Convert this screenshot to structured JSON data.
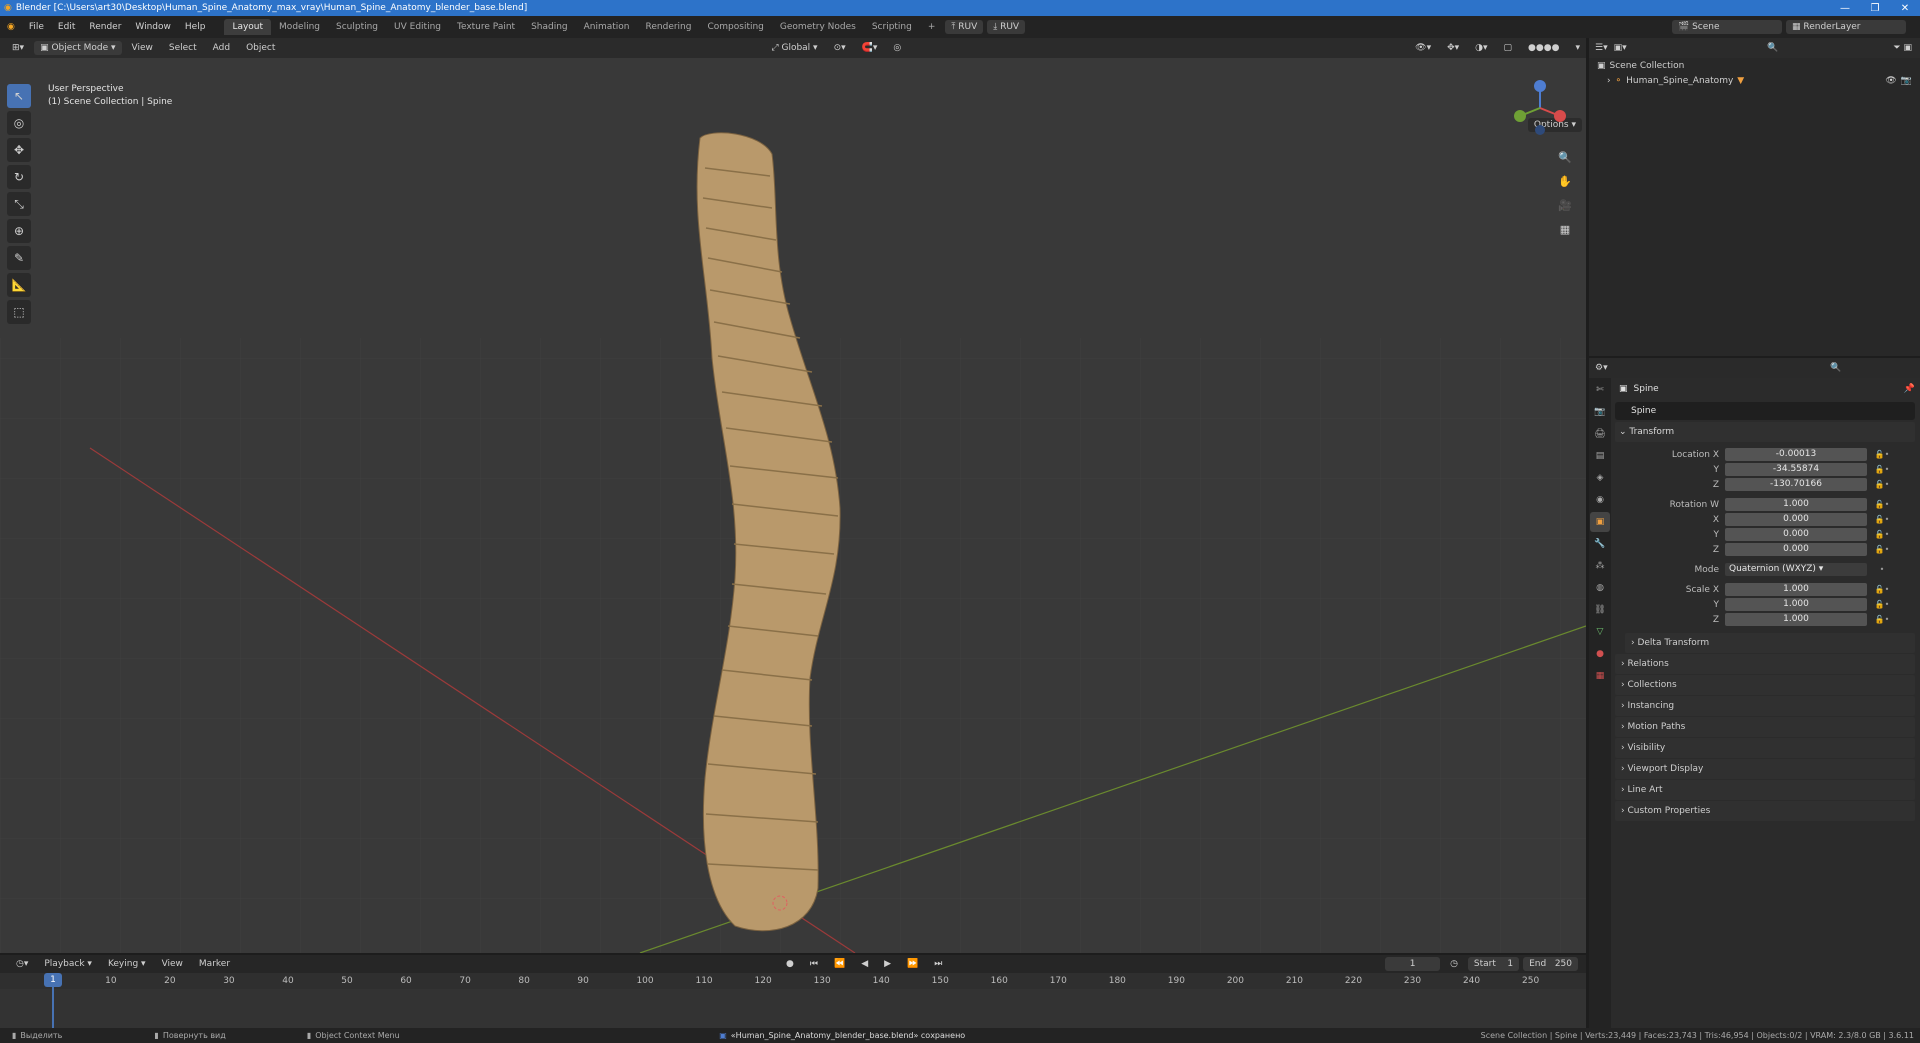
{
  "titlebar": {
    "title": "Blender [C:\\Users\\art30\\Desktop\\Human_Spine_Anatomy_max_vray\\Human_Spine_Anatomy_blender_base.blend]"
  },
  "menu": [
    "File",
    "Edit",
    "Render",
    "Window",
    "Help"
  ],
  "workspaces": [
    "Layout",
    "Modeling",
    "Sculpting",
    "UV Editing",
    "Texture Paint",
    "Shading",
    "Animation",
    "Rendering",
    "Compositing",
    "Geometry Nodes",
    "Scripting"
  ],
  "topright": {
    "scene": "Scene",
    "view_layer": "RenderLayer",
    "ruv1": "RUV",
    "ruv2": "RUV"
  },
  "viewport_header": {
    "mode": "Object Mode",
    "view": "View",
    "select": "Select",
    "add": "Add",
    "object": "Object",
    "transform": "Global",
    "options": "Options"
  },
  "viewport": {
    "perspective": "User Perspective",
    "collection": "(1) Scene Collection | Spine"
  },
  "outliner": {
    "root": "Scene Collection",
    "item": "Human_Spine_Anatomy"
  },
  "props": {
    "object_name": "Spine",
    "field_name": "Spine",
    "transform_title": "Transform",
    "location": {
      "label": "Location X",
      "x": "-0.00013",
      "y": "-34.55874",
      "z": "-130.70166"
    },
    "rotation": {
      "label": "Rotation W",
      "w": "1.000",
      "x": "0.000",
      "y": "0.000",
      "z": "0.000"
    },
    "mode": {
      "label": "Mode",
      "value": "Quaternion (WXYZ)"
    },
    "scale": {
      "label": "Scale X",
      "x": "1.000",
      "y": "1.000",
      "z": "1.000"
    },
    "axis_y": "Y",
    "axis_z": "Z",
    "axis_x": "X",
    "panels": [
      "Delta Transform",
      "Relations",
      "Collections",
      "Instancing",
      "Motion Paths",
      "Visibility",
      "Viewport Display",
      "Line Art",
      "Custom Properties"
    ]
  },
  "timeline": {
    "menu": [
      "Playback",
      "Keying",
      "View",
      "Marker"
    ],
    "current": "1",
    "start_label": "Start",
    "start": "1",
    "end_label": "End",
    "end": "250",
    "ticks": [
      "1",
      "10",
      "20",
      "30",
      "40",
      "50",
      "60",
      "70",
      "80",
      "90",
      "100",
      "110",
      "120",
      "130",
      "140",
      "150",
      "160",
      "170",
      "180",
      "190",
      "200",
      "210",
      "220",
      "230",
      "240",
      "250"
    ]
  },
  "status": {
    "left1": "Выделить",
    "left2": "Повернуть вид",
    "left3": "Object Context Menu",
    "center": "«Human_Spine_Anatomy_blender_base.blend» сохранено",
    "right": "Scene Collection | Spine | Verts:23,449 | Faces:23,743 | Tris:46,954 | Objects:0/2 | VRAM: 2.3/8.0 GB | 3.6.11"
  }
}
